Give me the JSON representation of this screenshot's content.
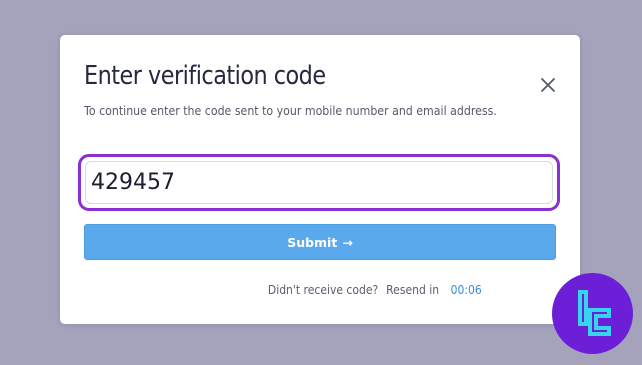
{
  "modal": {
    "title": "Enter verification code",
    "subtitle": "To continue enter the code sent to your mobile number and email address.",
    "code_value": "429457",
    "submit_label": "Submit",
    "submit_arrow": "→",
    "resend_prompt": "Didn't receive code?",
    "resend_label": "Resend in",
    "timer": "00:06"
  },
  "icons": {
    "close": "close-icon",
    "brand": "brand-logo-icon"
  },
  "colors": {
    "backdrop": "#a5a3bc",
    "input_focus_border": "#8a2fd1",
    "submit_background": "#5aa9ec",
    "timer_text": "#3b8fd6",
    "brand_badge": "#6c1fd6",
    "brand_glyph": "#35d5f0"
  }
}
